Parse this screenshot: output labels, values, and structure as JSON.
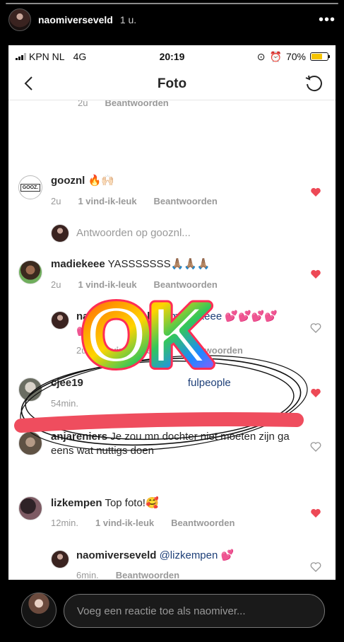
{
  "story": {
    "username": "naomiverseveld",
    "time": "1 u.",
    "more": "•••"
  },
  "status": {
    "carrier": "KPN NL",
    "network": "4G",
    "time": "20:19",
    "battery": "70%",
    "battery_level": 0.7
  },
  "nav": {
    "title": "Foto"
  },
  "comments": [
    {
      "meta_time": "2u",
      "reply": "Beantwoorden"
    },
    {
      "user": "gooznl",
      "text": "🔥🙌🏻",
      "time": "2u",
      "likes": "1 vind-ik-leuk",
      "reply": "Beantwoorden",
      "liked": true
    },
    {
      "reply_prompt": "Antwoorden op gooznl..."
    },
    {
      "user": "madiekeee",
      "text": "YASSSSSSS🙏🏽🙏🏽🙏🏽",
      "time": "2u",
      "likes": "1 vind-ik-leuk",
      "reply": "Beantwoorden",
      "liked": true
    },
    {
      "user": "naomiverseveld",
      "mention": "@madiekeee",
      "text": "💕💕💕💕💕💕",
      "time": "2u",
      "likes": "1 vind-ik-leuk",
      "reply": "Beantwoorden",
      "liked": false
    },
    {
      "user": "cjee19",
      "text": "fulpeople",
      "time": "54min.",
      "liked": true
    },
    {
      "user": "anjareniers",
      "text": "Je zou mn dochter niet moeten zijn ga eens wat nuttigs doen",
      "liked": false
    },
    {
      "user": "lizkempen",
      "text": "Top foto!🥰",
      "time": "12min.",
      "likes": "1 vind-ik-leuk",
      "reply": "Beantwoorden",
      "liked": true
    },
    {
      "user": "naomiverseveld",
      "mention": "@lizkempen",
      "text": "💕",
      "time": "6min.",
      "reply": "Beantwoorden",
      "liked": false
    }
  ],
  "sticker": {
    "text": "OK"
  },
  "emojis": [
    "❤️",
    "😍",
    "😘",
    "💕",
    "🔥",
    "🙏🏻",
    "💁🏼",
    "😂"
  ],
  "input": {
    "placeholder": "Voeg een reactie toe als naomiver..."
  },
  "colors": {
    "heart_red": "#ed4956",
    "mention": "#1d3f78",
    "scribble": "#ef4d5e"
  }
}
